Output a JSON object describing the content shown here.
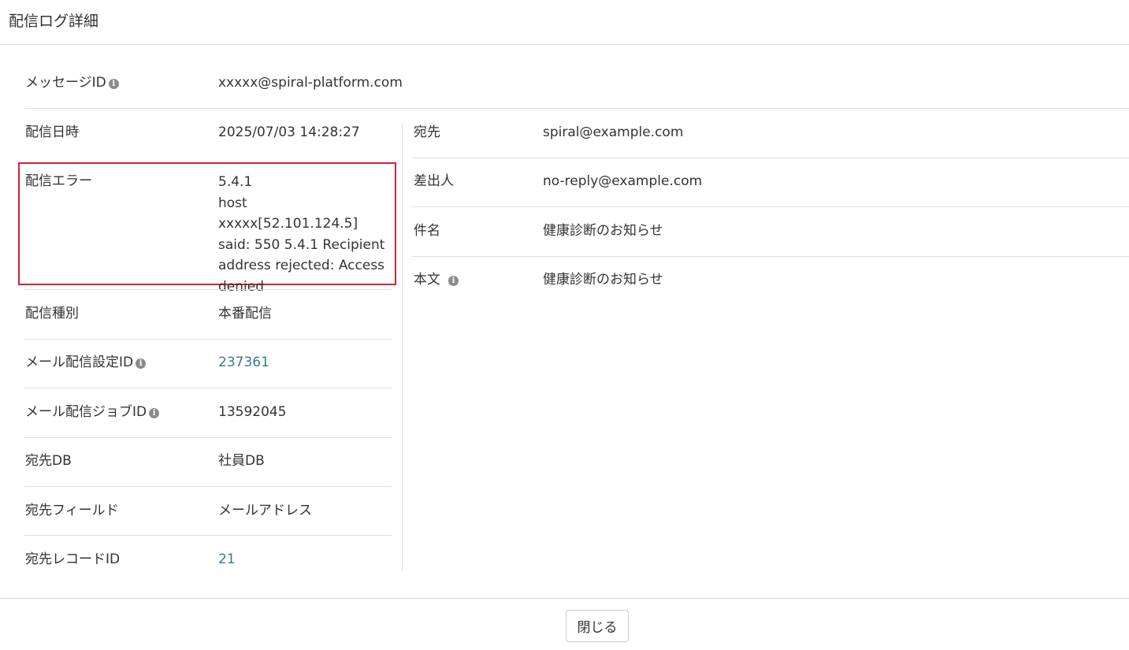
{
  "header": {
    "title": "配信ログ詳細"
  },
  "message_id": {
    "label": "メッセージID",
    "value": "xxxxx@spiral-platform.com"
  },
  "left": {
    "delivery_datetime": {
      "label": "配信日時",
      "value": "2025/07/03 14:28:27"
    },
    "delivery_error": {
      "label": "配信エラー",
      "value": "5.4.1\nhost xxxxx[52.101.124.5]\nsaid: 550 5.4.1 Recipient\naddress rejected: Access\ndenied"
    },
    "delivery_type": {
      "label": "配信種別",
      "value": "本番配信"
    },
    "mail_setting_id": {
      "label": "メール配信設定ID",
      "value": "237361"
    },
    "mail_job_id": {
      "label": "メール配信ジョブID",
      "value": "13592045"
    },
    "recipient_db": {
      "label": "宛先DB",
      "value": "社員DB"
    },
    "recipient_field": {
      "label": "宛先フィールド",
      "value": "メールアドレス"
    },
    "recipient_record_id": {
      "label": "宛先レコードID",
      "value": "21"
    }
  },
  "right": {
    "to": {
      "label": "宛先",
      "value": "spiral@example.com"
    },
    "from": {
      "label": "差出人",
      "value": "no-reply@example.com"
    },
    "subject": {
      "label": "件名",
      "value": "健康診断のお知らせ"
    },
    "body": {
      "label": "本文",
      "value": "健康診断のお知らせ"
    }
  },
  "footer": {
    "close_label": "閉じる"
  },
  "colors": {
    "link": "#3d7a8c",
    "highlight_border": "#d1262d",
    "divider": "#dedede"
  }
}
